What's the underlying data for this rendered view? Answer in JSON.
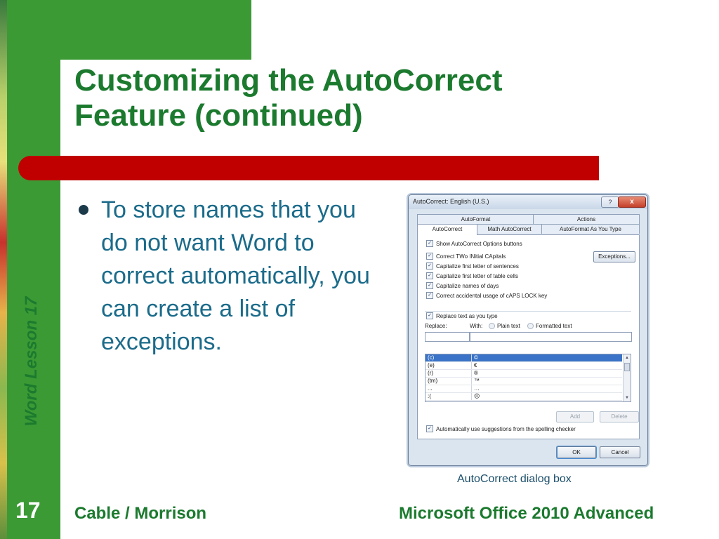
{
  "slide": {
    "title": "Customizing the AutoCorrect Feature (continued)",
    "side_label": "Word Lesson 17",
    "bullet": "To store names that you do not want Word to correct automatically, you can create a list of exceptions.",
    "caption": "AutoCorrect dialog box",
    "slide_number": "17",
    "footer_left": "Cable / Morrison",
    "footer_right": "Microsoft Office 2010 Advanced",
    "colors": {
      "green": "#3c9a35",
      "title_green": "#1b7a2e",
      "red_bar": "#c00000",
      "body_text": "#1b6b8a"
    }
  },
  "dialog": {
    "title": "AutoCorrect: English (U.S.)",
    "help_label": "?",
    "close_label": "x",
    "tabs_row1": [
      "AutoFormat",
      "Actions"
    ],
    "tabs_row2": [
      "AutoCorrect",
      "Math AutoCorrect",
      "AutoFormat As You Type"
    ],
    "active_tab": "AutoCorrect",
    "show_options": "Show AutoCorrect Options buttons",
    "options": [
      "Correct TWo INitial CApitals",
      "Capitalize first letter of sentences",
      "Capitalize first letter of table cells",
      "Capitalize names of days",
      "Correct accidental usage of cAPS LOCK key"
    ],
    "exceptions_button": "Exceptions...",
    "replace_as_you_type": "Replace text as you type",
    "replace_label": "Replace:",
    "with_label": "With:",
    "plain_text": "Plain text",
    "formatted_text": "Formatted text",
    "entries": [
      {
        "replace": "(c)",
        "with": "©"
      },
      {
        "replace": "(e)",
        "with": "€"
      },
      {
        "replace": "(r)",
        "with": "®"
      },
      {
        "replace": "(tm)",
        "with": "™"
      },
      {
        "replace": "...",
        "with": "…"
      },
      {
        "replace": ":(",
        "with": "☹"
      }
    ],
    "add_button": "Add",
    "delete_button": "Delete",
    "spelling_suggestions": "Automatically use suggestions from the spelling checker",
    "ok_button": "OK",
    "cancel_button": "Cancel",
    "check_glyph": "✓",
    "scroll_up": "▲",
    "scroll_down": "▼"
  }
}
